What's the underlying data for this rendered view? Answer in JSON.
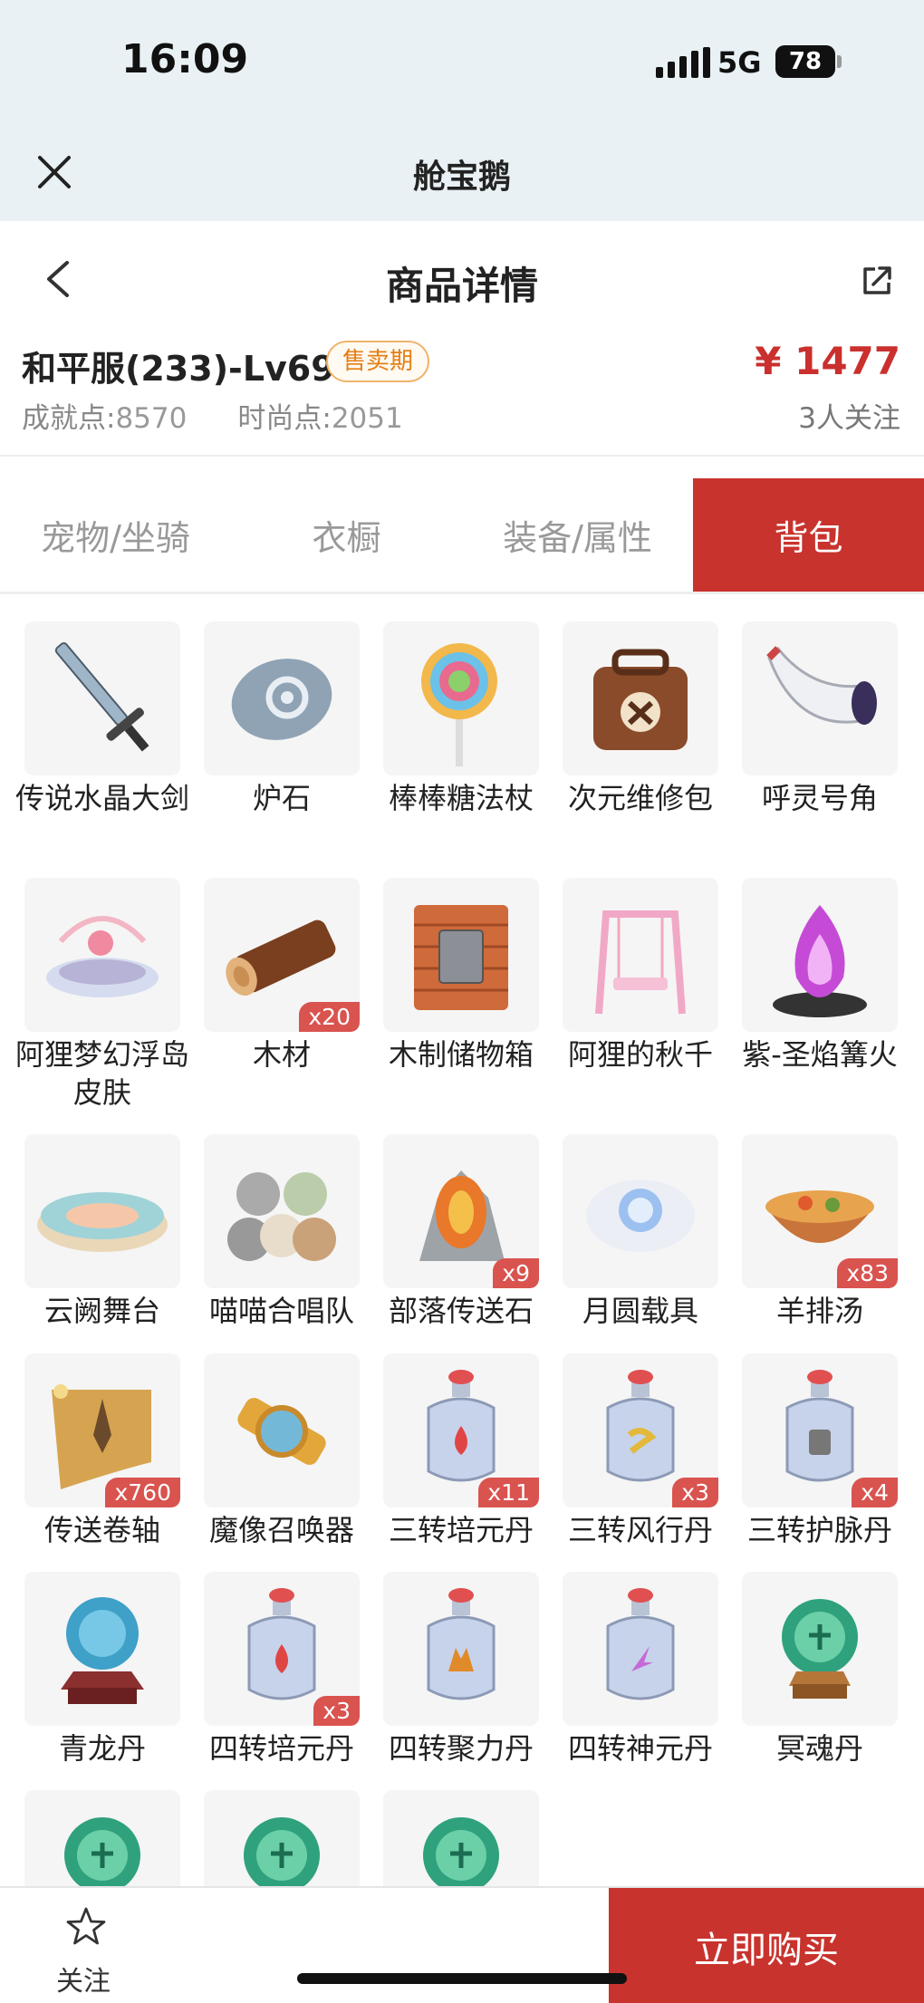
{
  "status_bar": {
    "time": "16:09",
    "network": "5G",
    "battery": "78"
  },
  "mini_app": {
    "title": "舱宝鹅"
  },
  "header": {
    "title": "商品详情"
  },
  "product": {
    "name": "和平服(233)-Lv69",
    "badge": "售卖期",
    "achievement_label": "成就点:",
    "achievement_value": "8570",
    "fashion_label": "时尚点:",
    "fashion_value": "2051",
    "price": "¥ 1477",
    "followers": "3人关注"
  },
  "tabs": [
    {
      "label": "宠物/坐骑",
      "active": false
    },
    {
      "label": "衣橱",
      "active": false
    },
    {
      "label": "装备/属性",
      "active": false
    },
    {
      "label": "背包",
      "active": true
    }
  ],
  "items": [
    {
      "name": "传说水晶大剑",
      "count": "",
      "icon": "sword-icon"
    },
    {
      "name": "炉石",
      "count": "",
      "icon": "hearthstone-icon"
    },
    {
      "name": "棒棒糖法杖",
      "count": "",
      "icon": "lollipop-icon"
    },
    {
      "name": "次元维修包",
      "count": "",
      "icon": "repair-bag-icon"
    },
    {
      "name": "呼灵号角",
      "count": "",
      "icon": "horn-icon"
    },
    {
      "name": "阿狸梦幻浮岛皮肤",
      "count": "",
      "icon": "floating-island-icon"
    },
    {
      "name": "木材",
      "count": "x20",
      "icon": "wood-log-icon"
    },
    {
      "name": "木制储物箱",
      "count": "",
      "icon": "wooden-crate-icon"
    },
    {
      "name": "阿狸的秋千",
      "count": "",
      "icon": "swing-icon"
    },
    {
      "name": "紫-圣焰篝火",
      "count": "",
      "icon": "bonfire-icon"
    },
    {
      "name": "云阙舞台",
      "count": "",
      "icon": "stage-icon"
    },
    {
      "name": "喵喵合唱队",
      "count": "",
      "icon": "cats-icon"
    },
    {
      "name": "部落传送石",
      "count": "x9",
      "icon": "teleport-stone-icon"
    },
    {
      "name": "月圆载具",
      "count": "",
      "icon": "moon-vehicle-icon"
    },
    {
      "name": "羊排汤",
      "count": "x83",
      "icon": "soup-icon"
    },
    {
      "name": "传送卷轴",
      "count": "x760",
      "icon": "scroll-icon"
    },
    {
      "name": "魔像召唤器",
      "count": "",
      "icon": "golem-summoner-icon"
    },
    {
      "name": "三转培元丹",
      "count": "x11",
      "icon": "potion-red-icon"
    },
    {
      "name": "三转风行丹",
      "count": "x3",
      "icon": "potion-yellow-icon"
    },
    {
      "name": "三转护脉丹",
      "count": "x4",
      "icon": "potion-grey-icon"
    },
    {
      "name": "青龙丹",
      "count": "",
      "icon": "dragon-orb-icon"
    },
    {
      "name": "四转培元丹",
      "count": "x3",
      "icon": "potion-red-icon"
    },
    {
      "name": "四转聚力丹",
      "count": "",
      "icon": "potion-orange-icon"
    },
    {
      "name": "四转神元丹",
      "count": "",
      "icon": "potion-pink-icon"
    },
    {
      "name": "冥魂丹",
      "count": "",
      "icon": "green-orb-icon"
    },
    {
      "name": "",
      "count": "",
      "icon": "green-orb-icon"
    },
    {
      "name": "",
      "count": "",
      "icon": "green-orb-icon"
    },
    {
      "name": "",
      "count": "",
      "icon": "green-orb-icon"
    }
  ],
  "bottom_bar": {
    "follow_label": "关注",
    "buy_label": "立即购买"
  },
  "colors": {
    "accent": "#c8332e",
    "price": "#c9302e",
    "badge": "#e57e15",
    "top_bg": "#e9f1f5"
  }
}
